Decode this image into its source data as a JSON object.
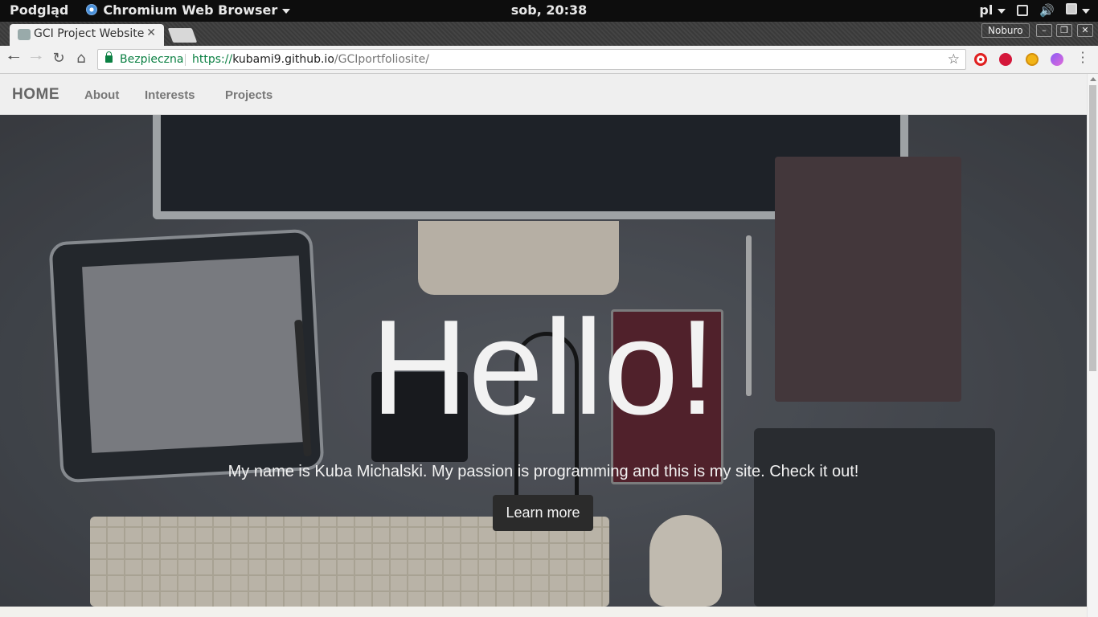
{
  "os_panel": {
    "app_menu": "Podgląd",
    "browser_menu": "Chromium Web Browser",
    "clock": "sob, 20:38",
    "keyboard_layout": "pl"
  },
  "browser": {
    "tab_title": "GCI Project Website",
    "profile_name": "Noburo",
    "security_label": "Bezpieczna",
    "url_scheme": "https://",
    "url_host": "kubami9.github.io",
    "url_path": "/GCIportfoliosite/"
  },
  "nav": {
    "brand": "HOME",
    "links": [
      "About",
      "Interests",
      "Projects"
    ]
  },
  "hero": {
    "title": "Hello!",
    "subtitle": "My name is Kuba Michalski. My passion is programming and this is my site. Check it out!",
    "button": "Learn more"
  },
  "icons": {
    "back": "arrow-left-icon",
    "forward": "arrow-right-icon",
    "reload": "reload-icon",
    "home": "home-icon",
    "bookmark": "star-icon"
  },
  "colors": {
    "secure_green": "#0b8043",
    "hero_button": "#2b2b2b",
    "nav_bg": "#efefef"
  }
}
